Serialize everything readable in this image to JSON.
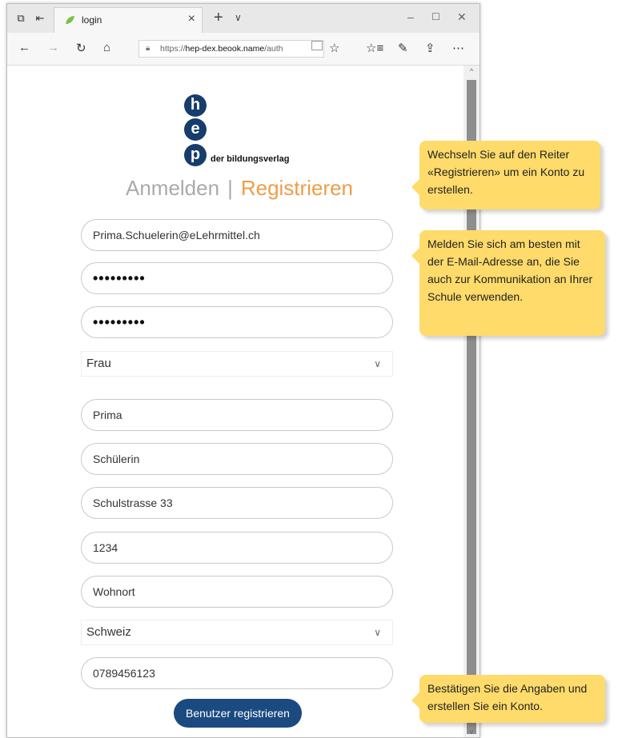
{
  "browser": {
    "tab_title": "login",
    "new_tab_label": "+",
    "tab_menu_label": "∨",
    "url_prefix": "https://",
    "url_host": "hep-dex.beook.name",
    "url_path": "/auth",
    "window_controls": [
      "–",
      "☐",
      "✕"
    ],
    "nav_icons": [
      "back-icon",
      "forward-icon",
      "refresh-icon",
      "home-icon"
    ],
    "toolbar_icons": [
      "favorites-icon",
      "favorites-list-icon",
      "pen-icon",
      "share-icon",
      "more-icon"
    ]
  },
  "logo": {
    "letters": [
      "h",
      "e",
      "p"
    ],
    "text": "der bildungsverlag",
    "color": "#163d6b"
  },
  "auth_tabs": {
    "login": "Anmelden",
    "separator": "|",
    "register": "Registrieren",
    "register_color": "#ef9d47"
  },
  "form": {
    "email": "Prima.Schuelerin@eLehrmittel.ch",
    "password": "•••••••••",
    "password_confirm": "•••••••••",
    "salutation": "Frau",
    "first_name": "Prima",
    "last_name": "Schülerin",
    "street": "Schulstrasse 33",
    "zip": "1234",
    "city": "Wohnort",
    "country": "Schweiz",
    "phone": "0789456123",
    "submit_label": "Benutzer registrieren",
    "submit_color": "#1a4a80"
  },
  "callouts": [
    {
      "text": "Wechseln Sie auf den Reiter «Registrieren» um ein Konto zu erstellen."
    },
    {
      "text": "Melden Sie sich am besten mit der E-Mail-Adresse an, die Sie auch zur Kommunikation an Ihrer Schule verwenden."
    },
    {
      "text": "Bestätigen Sie die Angaben und erstellen Sie ein Konto."
    }
  ],
  "callout_color": "#fedb6a"
}
